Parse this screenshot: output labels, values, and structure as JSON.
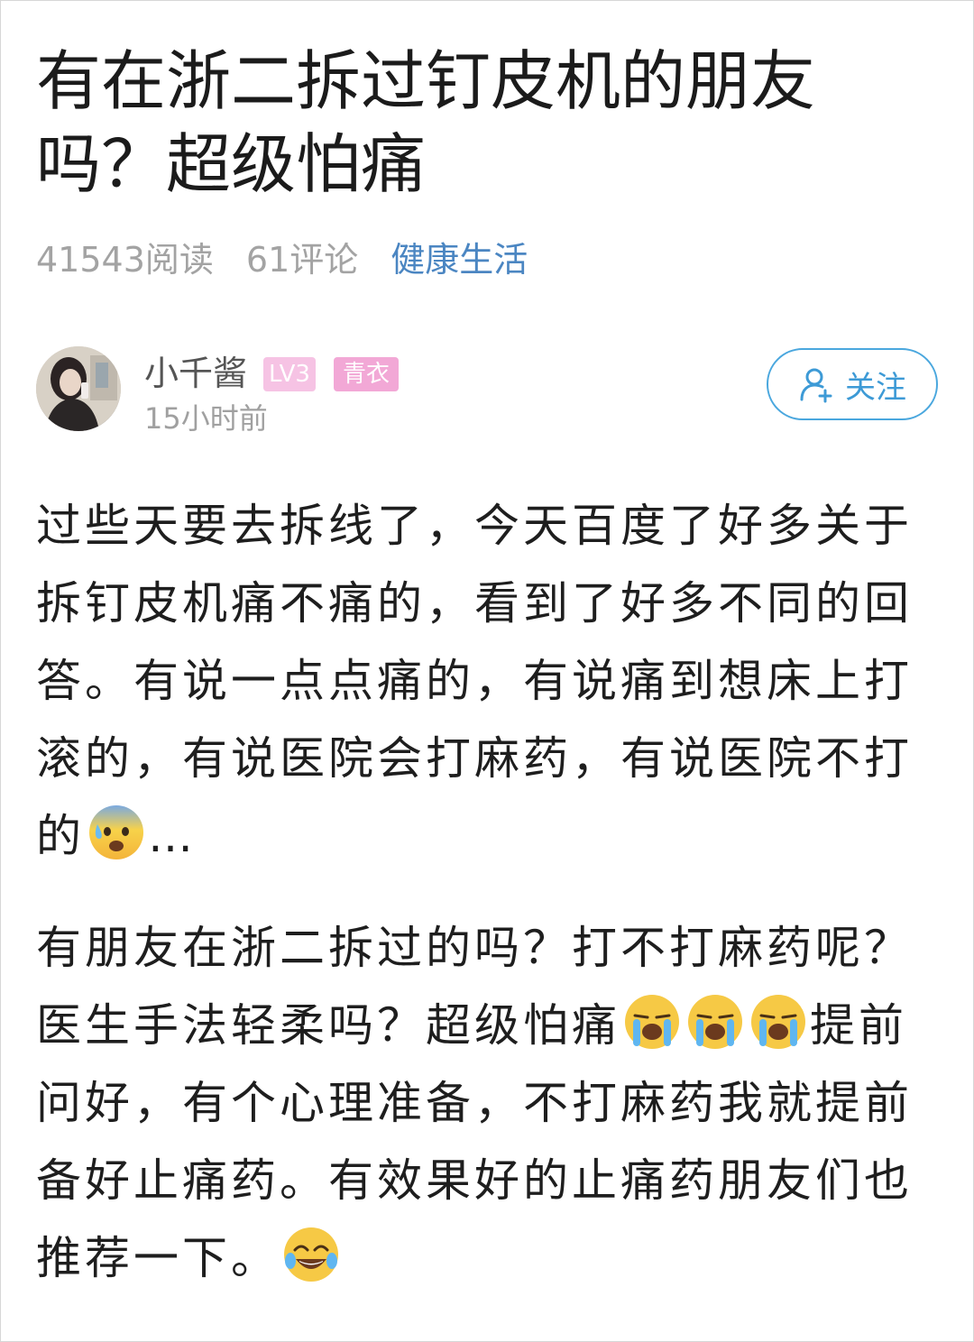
{
  "post": {
    "title": "有在浙二拆过钉皮机的朋友吗？超级怕痛",
    "reads": "41543阅读",
    "comments": "61评论",
    "category": "健康生活"
  },
  "author": {
    "name": "小千酱",
    "level": "LV3",
    "tag": "青衣",
    "time": "15小时前",
    "follow_label": "关注",
    "icons": {
      "follow": "add-user-icon",
      "avatar": "user-avatar-photo"
    }
  },
  "content": {
    "paragraph1": {
      "text": "过些天要去拆线了，今天百度了好多关于拆钉皮机痛不痛的，看到了好多不同的回答。有说一点点痛的，有说痛到想床上打滚的，有说医院会打麻药，有说医院不打的",
      "emoji": "anxious-sweat-emoji",
      "tail": "…"
    },
    "paragraph2": {
      "text1": "有朋友在浙二拆过的吗？打不打麻药呢？医生手法轻柔吗？超级怕痛",
      "emojis": [
        "loudly-crying-emoji",
        "loudly-crying-emoji",
        "loudly-crying-emoji"
      ],
      "text2": "提前问好，有个心理准备，不打麻药我就提前备好止痛药。有效果好的止痛药朋友们也推荐一下。",
      "end_emoji": "tears-of-joy-emoji"
    }
  },
  "colors": {
    "accent": "#4aa7de",
    "category": "#4b86c2",
    "meta": "#a3a3a3",
    "badge_pink": "#f2a8d6"
  }
}
